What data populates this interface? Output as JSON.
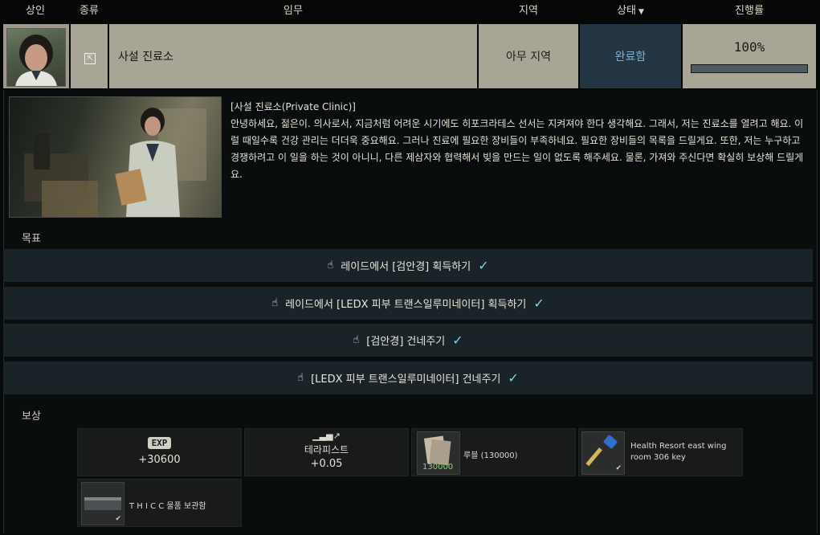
{
  "header": {
    "trader": "상인",
    "type": "종류",
    "task": "임무",
    "location": "지역",
    "status": "상태",
    "progress": "진행률"
  },
  "quest": {
    "name": "사설 진료소",
    "location": "아무 지역",
    "status": "완료함",
    "progress_text": "100%",
    "progress_fraction": 1.0,
    "type_icon": "exit-icon"
  },
  "description": {
    "title": "[사설 진료소(Private Clinic)]",
    "body": "안녕하세요, 젊은이. 의사로서, 지금처럼 어려운 시기에도 히포크라테스 선서는 지켜져야 한다 생각해요. 그래서, 저는 진료소를 열려고 해요. 이럴 때일수록 건강 관리는 더더욱 중요해요. 그러나 진료에 필요한 장비들이 부족하네요. 필요한 장비들의 목록을 드릴게요. 또한, 저는 누구하고 경쟁하려고 이 일을 하는 것이 아니니, 다른 제삼자와 협력해서 빚을 만드는 일이 없도록 해주세요. 물론, 가져와 주신다면 확실히 보상해 드릴게요."
  },
  "objectives_label": "목표",
  "objectives": [
    "레이드에서 [검안경] 획득하기",
    "레이드에서 [LEDX 피부 트랜스일루미네이터] 획득하기",
    "[검안경] 건네주기",
    "[LEDX 피부 트랜스일루미네이터] 건네주기"
  ],
  "rewards_label": "보상",
  "rewards": {
    "exp_badge": "EXP",
    "exp_value": "+30600",
    "rep_trader": "테라피스트",
    "rep_value": "+0.05",
    "money_label": "루블 (130000)",
    "money_amount": "130000",
    "key_label": "Health Resort east wing room 306 key",
    "container_label": "T H I C C 물품 보관함"
  },
  "colors": {
    "status_bg": "#233543",
    "status_text": "#7fb0cf",
    "check": "#7fd2ec",
    "objective_bg": "#1a2327"
  }
}
